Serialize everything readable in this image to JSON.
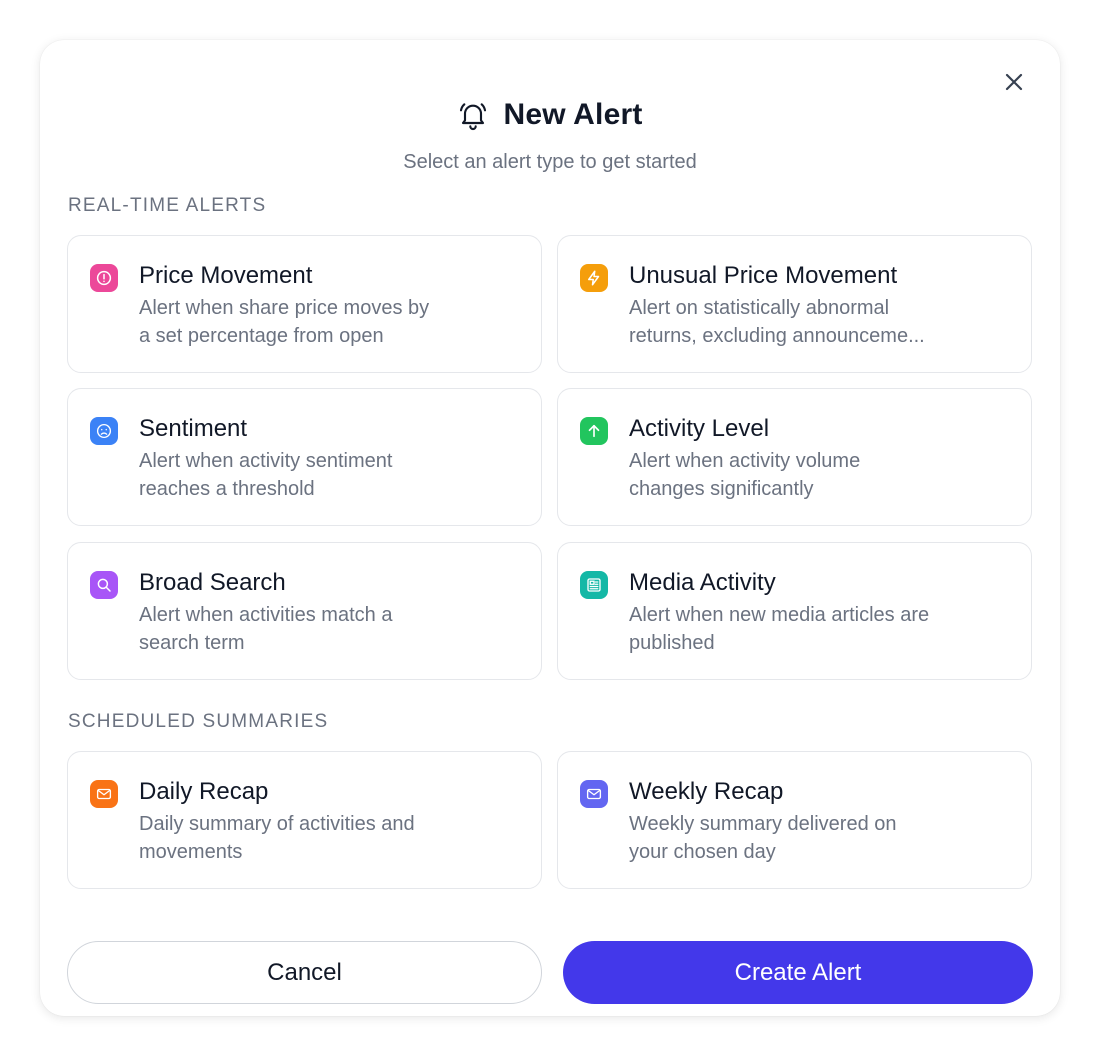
{
  "dialog": {
    "title": "New Alert",
    "subtitle": "Select an alert type to get started",
    "icon": "bell-icon",
    "close_icon": "close-icon"
  },
  "sections": {
    "realtime": "REAL-TIME ALERTS",
    "scheduled": "SCHEDULED SUMMARIES"
  },
  "cards": {
    "price_movement": {
      "title": "Price Movement",
      "desc1": "Alert when share price moves by",
      "desc2": "a set percentage from open",
      "icon": "alert-circle-icon",
      "color": "#ec4899"
    },
    "unusual_price_movement": {
      "title": "Unusual Price Movement",
      "desc1": "Alert on statistically abnormal",
      "desc2": "returns, excluding announceme...",
      "icon": "lightning-icon",
      "color": "#f59e0b"
    },
    "sentiment": {
      "title": "Sentiment",
      "desc1": "Alert when activity sentiment",
      "desc2": "reaches a threshold",
      "icon": "frown-face-icon",
      "color": "#3b82f6"
    },
    "activity_level": {
      "title": "Activity Level",
      "desc1": "Alert when activity volume",
      "desc2": "changes significantly",
      "icon": "arrow-up-icon",
      "color": "#22c55e"
    },
    "broad_search": {
      "title": "Broad Search",
      "desc1": "Alert when activities match a",
      "desc2": "search term",
      "icon": "search-icon",
      "color": "#a855f7"
    },
    "media_activity": {
      "title": "Media Activity",
      "desc1": "Alert when new media articles are",
      "desc2": "published",
      "icon": "newspaper-icon",
      "color": "#14b8a6"
    },
    "daily_recap": {
      "title": "Daily Recap",
      "desc1": "Daily summary of activities and",
      "desc2": "movements",
      "icon": "mail-icon",
      "color": "#f97316"
    },
    "weekly_recap": {
      "title": "Weekly Recap",
      "desc1": "Weekly summary delivered on",
      "desc2": "your chosen day",
      "icon": "mail-icon",
      "color": "#6366f1"
    }
  },
  "buttons": {
    "cancel": "Cancel",
    "create": "Create Alert",
    "primary_color": "#4338ea"
  }
}
